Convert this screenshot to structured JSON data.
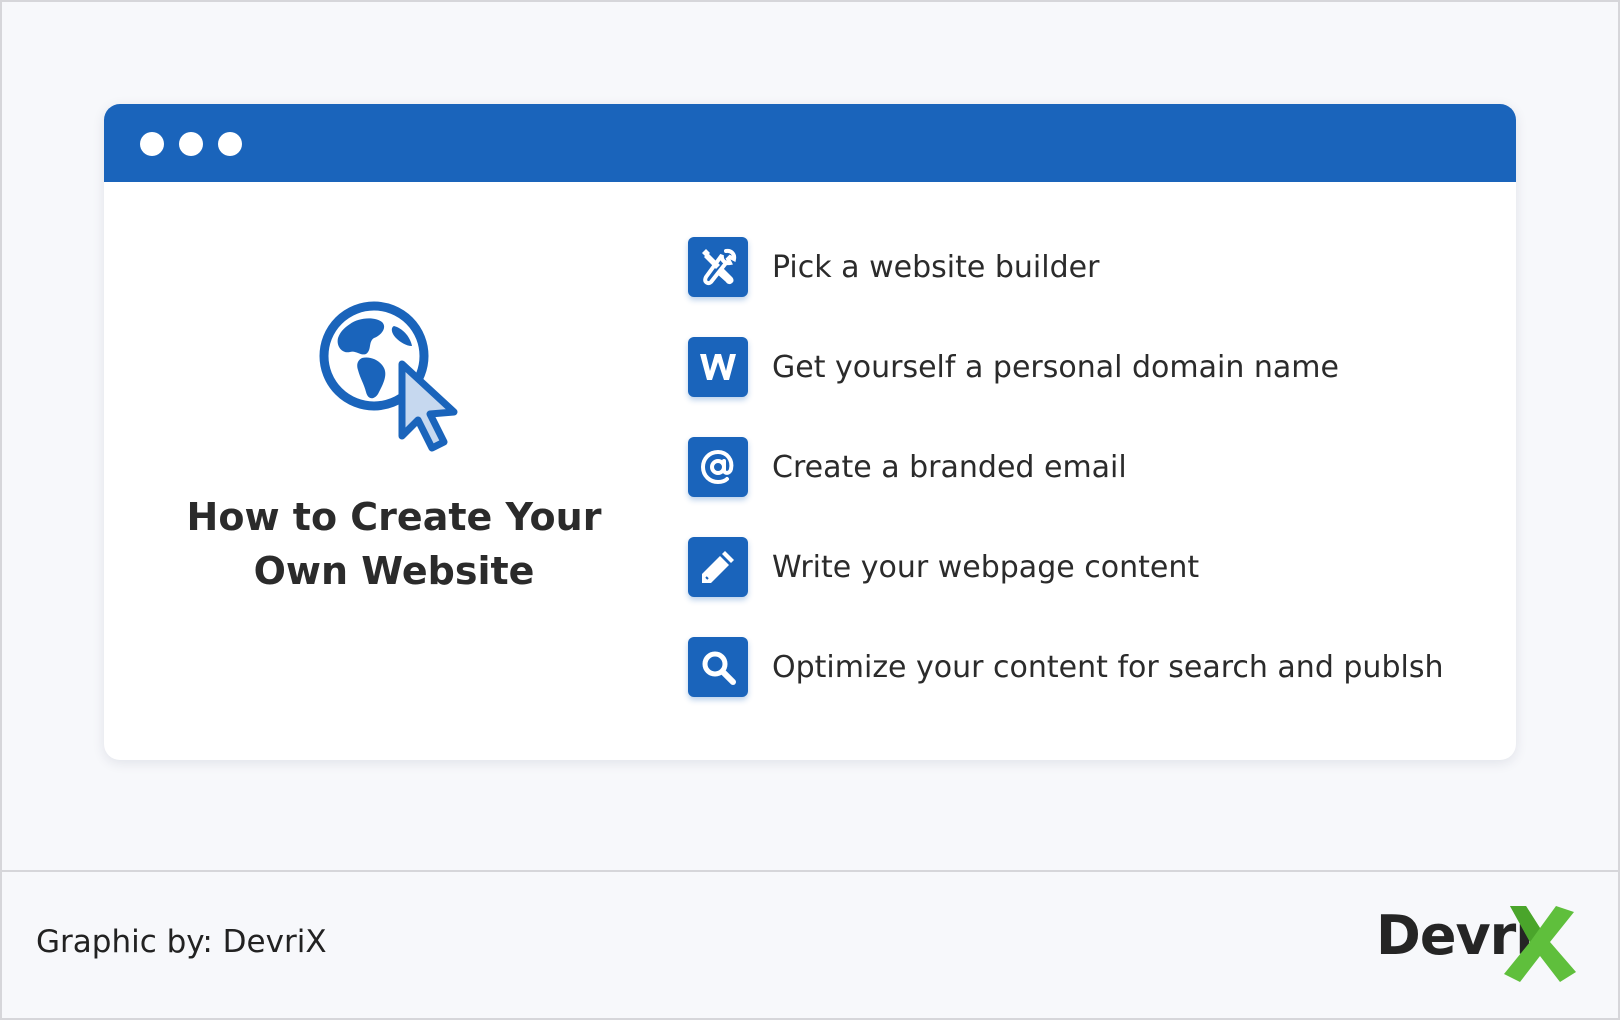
{
  "window": {
    "dot_color": "#ffffff",
    "titlebar_color": "#1a64bb"
  },
  "hero": {
    "icon": "globe-cursor-icon",
    "title_line1": "How to Create Your",
    "title_line2": "Own Website"
  },
  "steps": [
    {
      "icon": "tools-icon",
      "label": "Pick a website builder"
    },
    {
      "icon": "w-letter-icon",
      "label": "Get yourself a personal domain name"
    },
    {
      "icon": "at-sign-icon",
      "label": "Create a branded email"
    },
    {
      "icon": "pencil-icon",
      "label": "Write your webpage content"
    },
    {
      "icon": "search-icon",
      "label": "Optimize your content for search and publsh"
    }
  ],
  "footer": {
    "credit": "Graphic by: DevriX",
    "logo_text": "Devri",
    "logo_accent_color": "#5fbf3c"
  },
  "colors": {
    "accent": "#1a64bb",
    "background": "#f7f8fb",
    "text": "#2b2b2b"
  }
}
